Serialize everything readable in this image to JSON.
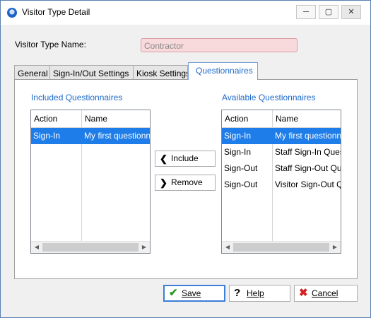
{
  "window": {
    "title": "Visitor Type Detail",
    "controls": {
      "minimize": "─",
      "maximize": "▢",
      "close": "✕"
    }
  },
  "form": {
    "name_label": "Visitor Type Name:",
    "name_value": "Contractor"
  },
  "tabs": [
    {
      "label": "General",
      "active": false
    },
    {
      "label": "Sign-In/Out Settings",
      "active": false
    },
    {
      "label": "Kiosk Settings",
      "active": false
    },
    {
      "label": "Questionnaires",
      "active": true
    }
  ],
  "included": {
    "label": "Included Questionnaires",
    "columns": [
      "Action",
      "Name"
    ],
    "rows": [
      {
        "action": "Sign-In",
        "name": "My first questionnaire",
        "selected": true
      }
    ]
  },
  "available": {
    "label": "Available Questionnaires",
    "columns": [
      "Action",
      "Name"
    ],
    "rows": [
      {
        "action": "Sign-In",
        "name": "My first questionnaire",
        "selected": true
      },
      {
        "action": "Sign-In",
        "name": "Staff Sign-In Questionnaire",
        "selected": false
      },
      {
        "action": "Sign-Out",
        "name": "Staff Sign-Out Questionnaire",
        "selected": false
      },
      {
        "action": "Sign-Out",
        "name": "Visitor Sign-Out Questionnaire",
        "selected": false
      }
    ]
  },
  "buttons": {
    "include": "Include",
    "remove": "Remove",
    "save": "Save",
    "help": "Help",
    "cancel": "Cancel"
  },
  "icons": {
    "app": "visitor-app-icon",
    "include": "chevron-left-icon",
    "remove": "chevron-right-icon",
    "save": "checkmark-icon",
    "help": "question-mark-icon",
    "cancel": "x-icon"
  },
  "colors": {
    "accent": "#1e6ac8",
    "selection": "#1e7de8",
    "name_field_bg": "#f8d9dc",
    "save_icon": "#2a9a2a",
    "cancel_icon": "#d42020"
  }
}
